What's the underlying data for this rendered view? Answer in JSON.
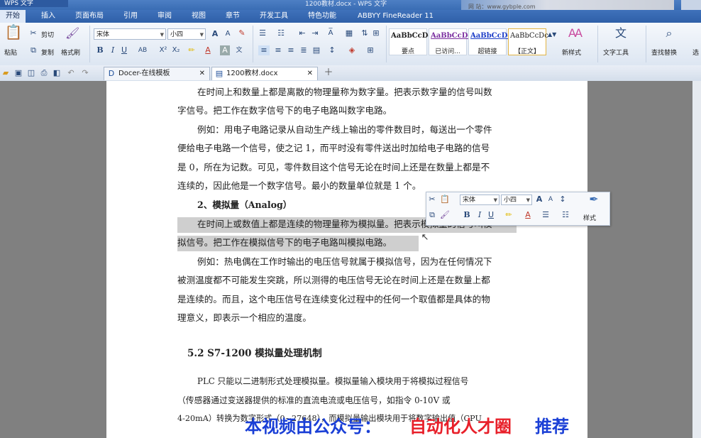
{
  "titlebar": {
    "app_menu": "WPS 文字",
    "window_title": "1200教材.docx - WPS 文字",
    "watermark": "网 站：www.gybple.com"
  },
  "menu": {
    "tabs": [
      "开始",
      "插入",
      "页面布局",
      "引用",
      "审阅",
      "视图",
      "章节",
      "开发工具",
      "特色功能",
      "ABBYY FineReader 11"
    ]
  },
  "ribbon": {
    "paste": "粘贴",
    "cut": "剪切",
    "copy": "复制",
    "format_painter": "格式刷",
    "font_name": "宋体",
    "font_size": "小四",
    "styles": [
      {
        "sample": "AaBbCcDc",
        "label": "要点",
        "color": "#000000"
      },
      {
        "sample": "AaBbCcDd",
        "label": "已访问...",
        "color": "#7b2fa0"
      },
      {
        "sample": "AaBbCcDd",
        "label": "超链接",
        "color": "#1f3fc8"
      },
      {
        "sample": "AaBbCcDc",
        "label": "【正文】",
        "color": "#000000"
      }
    ],
    "new_style": "新样式",
    "text_tools": "文字工具",
    "find_replace": "查找替换",
    "select": "选"
  },
  "doc_tabs": [
    {
      "label": "Docer-在线模板"
    },
    {
      "label": "1200教材.docx"
    }
  ],
  "document": {
    "lines": [
      "在时间上和数量上都是离散的物理量称为数字量。把表示数字量的信号叫数",
      "字信号。把工作在数字信号下的电子电路叫数字电路。",
      "例如：用电子电路记录从自动生产线上输出的零件数目时，每送出一个零件",
      "便给电子电路一个信号，使之记 1，而平时没有零件送出时加给电子电路的信号",
      "是 0，所在为记数。可见，零件数目这个信号无论在时间上还是在数量上都是不",
      "连续的，因此他是一个数字信号。最小的数量单位就是 1 个。",
      "2、模拟量（Analog）",
      "在时间上或数值上都是连续的物理量称为模拟量。把表示模拟量的信号叫模",
      "拟信号。把工作在模拟信号下的电子电路叫模拟电路。",
      "例如：热电偶在工作时输出的电压信号就属于模拟信号，因为在任何情况下",
      "被测温度都不可能发生突跳，所以测得的电压信号无论在时间上还是在数量上都",
      "是连续的。而且，这个电压信号在连续变化过程中的任何一个取值都是具体的物",
      "理意义，即表示一个相应的温度。",
      "5.2    S7-1200 模拟量处理机制",
      "PLC 只能以二进制形式处理模拟量。模拟量输入模块用于将模拟过程信号",
      "（传感器通过变送器提供的标准的直流电流或电压信号，如指令 0-10V 或",
      "4-20mA）转换为数字形式（0~27648），而模拟量输出模块用于将数字输出值（CPU"
    ]
  },
  "mini_toolbar": {
    "font_name": "宋体",
    "font_size": "小四",
    "style_label": "样式"
  },
  "banner": {
    "part1": "本视频由公众号：",
    "part2": "自动化人才圈",
    "part3": "推荐"
  }
}
